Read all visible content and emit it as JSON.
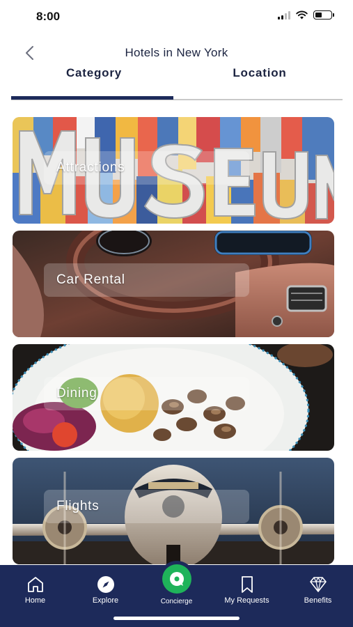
{
  "status_bar": {
    "time": "8:00",
    "signal_bars_on": 2,
    "signal_bars_total": 4,
    "battery_level": 0.45,
    "icons": [
      "cellular-signal-icon",
      "wifi-icon",
      "battery-icon"
    ]
  },
  "header": {
    "title": "Hotels in New York",
    "back_icon": "chevron-left-icon"
  },
  "tabs": [
    {
      "label": "Category",
      "active": true
    },
    {
      "label": "Location",
      "active": false
    }
  ],
  "categories": [
    {
      "label": "Attractions"
    },
    {
      "label": "Car Rental"
    },
    {
      "label": "Dining"
    },
    {
      "label": "Flights"
    }
  ],
  "bottom_nav": {
    "items": [
      {
        "label": "Home",
        "icon": "home-icon"
      },
      {
        "label": "Explore",
        "icon": "compass-icon"
      },
      {
        "label": "Concierge",
        "icon": "chat-icon"
      },
      {
        "label": "My Requests",
        "icon": "bookmark-icon"
      },
      {
        "label": "Benefits",
        "icon": "diamond-icon"
      }
    ]
  },
  "colors": {
    "navy": "#1d2a5a",
    "concierge_green": "#1fb35a",
    "tab_track": "#c8c8c8"
  }
}
